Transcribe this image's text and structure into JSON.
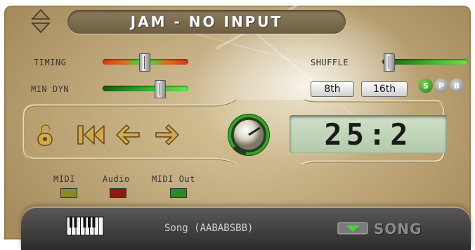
{
  "header": {
    "title": "JAM - NO INPUT"
  },
  "controls": {
    "timing_label": "TIMING",
    "timing_value": 0.48,
    "min_dyn_label": "MIN DYN",
    "min_dyn_value": 0.65,
    "shuffle_label": "SHUFFLE",
    "shuffle_value": 0.05,
    "eighth_label": "8th",
    "sixteenth_label": "16th",
    "spb": [
      "S",
      "P",
      "B"
    ]
  },
  "display": {
    "readout": "25:2"
  },
  "indicators": [
    {
      "label": "MIDI",
      "color": "#8b8a2a"
    },
    {
      "label": "Audio",
      "color": "#8a1a12"
    },
    {
      "label": "MIDI Out",
      "color": "#2a8a2a"
    }
  ],
  "song": {
    "text": "Song (AABABSBB)",
    "label": "SONG"
  },
  "colors": {
    "accent_gold": "#d4a94a",
    "track_green": "#3dbb2e",
    "track_red": "#d93a1c"
  }
}
